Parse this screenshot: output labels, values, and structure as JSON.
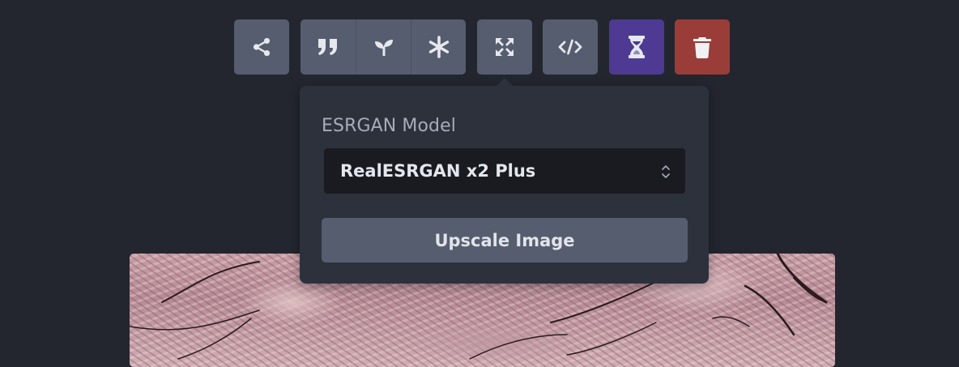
{
  "toolbar": {
    "buttons": [
      {
        "icon": "share-icon"
      },
      {
        "icon": "quote-icon"
      },
      {
        "icon": "sprout-icon"
      },
      {
        "icon": "asterisk-icon"
      },
      {
        "icon": "expand-icon"
      },
      {
        "icon": "code-icon"
      },
      {
        "icon": "hourglass-icon"
      },
      {
        "icon": "trash-icon"
      }
    ],
    "colors": {
      "default": "#555d6e",
      "hourglass": "#4e3a92",
      "trash": "#9a3d39"
    }
  },
  "upscale_popover": {
    "model_label": "ESRGAN Model",
    "selected_model": "RealESRGAN x2 Plus",
    "upscale_button_label": "Upscale Image"
  }
}
